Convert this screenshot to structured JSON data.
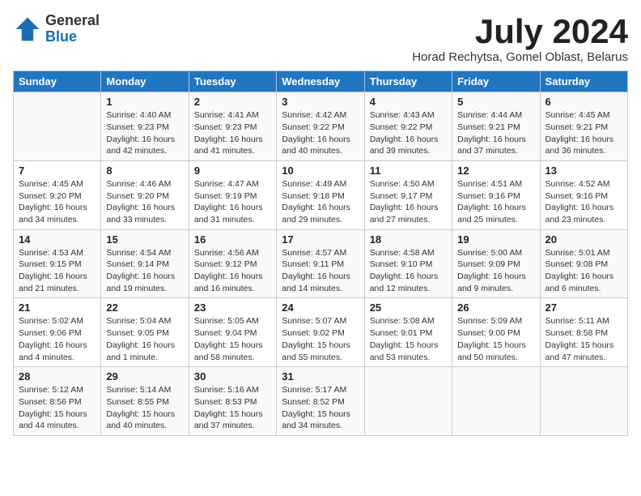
{
  "logo": {
    "general": "General",
    "blue": "Blue"
  },
  "title": {
    "month": "July 2024",
    "location": "Horad Rechytsa, Gomel Oblast, Belarus"
  },
  "days_of_week": [
    "Sunday",
    "Monday",
    "Tuesday",
    "Wednesday",
    "Thursday",
    "Friday",
    "Saturday"
  ],
  "weeks": [
    [
      {
        "day": "",
        "info": ""
      },
      {
        "day": "1",
        "info": "Sunrise: 4:40 AM\nSunset: 9:23 PM\nDaylight: 16 hours\nand 42 minutes."
      },
      {
        "day": "2",
        "info": "Sunrise: 4:41 AM\nSunset: 9:23 PM\nDaylight: 16 hours\nand 41 minutes."
      },
      {
        "day": "3",
        "info": "Sunrise: 4:42 AM\nSunset: 9:22 PM\nDaylight: 16 hours\nand 40 minutes."
      },
      {
        "day": "4",
        "info": "Sunrise: 4:43 AM\nSunset: 9:22 PM\nDaylight: 16 hours\nand 39 minutes."
      },
      {
        "day": "5",
        "info": "Sunrise: 4:44 AM\nSunset: 9:21 PM\nDaylight: 16 hours\nand 37 minutes."
      },
      {
        "day": "6",
        "info": "Sunrise: 4:45 AM\nSunset: 9:21 PM\nDaylight: 16 hours\nand 36 minutes."
      }
    ],
    [
      {
        "day": "7",
        "info": "Sunrise: 4:45 AM\nSunset: 9:20 PM\nDaylight: 16 hours\nand 34 minutes."
      },
      {
        "day": "8",
        "info": "Sunrise: 4:46 AM\nSunset: 9:20 PM\nDaylight: 16 hours\nand 33 minutes."
      },
      {
        "day": "9",
        "info": "Sunrise: 4:47 AM\nSunset: 9:19 PM\nDaylight: 16 hours\nand 31 minutes."
      },
      {
        "day": "10",
        "info": "Sunrise: 4:49 AM\nSunset: 9:18 PM\nDaylight: 16 hours\nand 29 minutes."
      },
      {
        "day": "11",
        "info": "Sunrise: 4:50 AM\nSunset: 9:17 PM\nDaylight: 16 hours\nand 27 minutes."
      },
      {
        "day": "12",
        "info": "Sunrise: 4:51 AM\nSunset: 9:16 PM\nDaylight: 16 hours\nand 25 minutes."
      },
      {
        "day": "13",
        "info": "Sunrise: 4:52 AM\nSunset: 9:16 PM\nDaylight: 16 hours\nand 23 minutes."
      }
    ],
    [
      {
        "day": "14",
        "info": "Sunrise: 4:53 AM\nSunset: 9:15 PM\nDaylight: 16 hours\nand 21 minutes."
      },
      {
        "day": "15",
        "info": "Sunrise: 4:54 AM\nSunset: 9:14 PM\nDaylight: 16 hours\nand 19 minutes."
      },
      {
        "day": "16",
        "info": "Sunrise: 4:56 AM\nSunset: 9:12 PM\nDaylight: 16 hours\nand 16 minutes."
      },
      {
        "day": "17",
        "info": "Sunrise: 4:57 AM\nSunset: 9:11 PM\nDaylight: 16 hours\nand 14 minutes."
      },
      {
        "day": "18",
        "info": "Sunrise: 4:58 AM\nSunset: 9:10 PM\nDaylight: 16 hours\nand 12 minutes."
      },
      {
        "day": "19",
        "info": "Sunrise: 5:00 AM\nSunset: 9:09 PM\nDaylight: 16 hours\nand 9 minutes."
      },
      {
        "day": "20",
        "info": "Sunrise: 5:01 AM\nSunset: 9:08 PM\nDaylight: 16 hours\nand 6 minutes."
      }
    ],
    [
      {
        "day": "21",
        "info": "Sunrise: 5:02 AM\nSunset: 9:06 PM\nDaylight: 16 hours\nand 4 minutes."
      },
      {
        "day": "22",
        "info": "Sunrise: 5:04 AM\nSunset: 9:05 PM\nDaylight: 16 hours\nand 1 minute."
      },
      {
        "day": "23",
        "info": "Sunrise: 5:05 AM\nSunset: 9:04 PM\nDaylight: 15 hours\nand 58 minutes."
      },
      {
        "day": "24",
        "info": "Sunrise: 5:07 AM\nSunset: 9:02 PM\nDaylight: 15 hours\nand 55 minutes."
      },
      {
        "day": "25",
        "info": "Sunrise: 5:08 AM\nSunset: 9:01 PM\nDaylight: 15 hours\nand 53 minutes."
      },
      {
        "day": "26",
        "info": "Sunrise: 5:09 AM\nSunset: 9:00 PM\nDaylight: 15 hours\nand 50 minutes."
      },
      {
        "day": "27",
        "info": "Sunrise: 5:11 AM\nSunset: 8:58 PM\nDaylight: 15 hours\nand 47 minutes."
      }
    ],
    [
      {
        "day": "28",
        "info": "Sunrise: 5:12 AM\nSunset: 8:56 PM\nDaylight: 15 hours\nand 44 minutes."
      },
      {
        "day": "29",
        "info": "Sunrise: 5:14 AM\nSunset: 8:55 PM\nDaylight: 15 hours\nand 40 minutes."
      },
      {
        "day": "30",
        "info": "Sunrise: 5:16 AM\nSunset: 8:53 PM\nDaylight: 15 hours\nand 37 minutes."
      },
      {
        "day": "31",
        "info": "Sunrise: 5:17 AM\nSunset: 8:52 PM\nDaylight: 15 hours\nand 34 minutes."
      },
      {
        "day": "",
        "info": ""
      },
      {
        "day": "",
        "info": ""
      },
      {
        "day": "",
        "info": ""
      }
    ]
  ]
}
